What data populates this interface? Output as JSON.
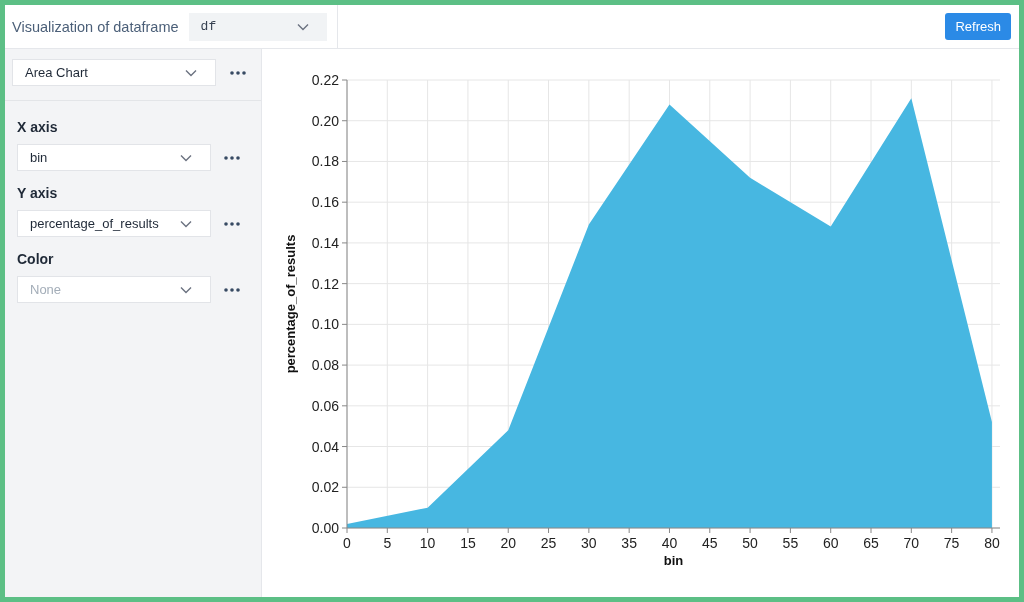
{
  "header": {
    "title": "Visualization of dataframe",
    "dataframe": "df",
    "refresh_button": "Refresh"
  },
  "sidebar": {
    "chart_type": "Area Chart",
    "fields": [
      {
        "label": "X axis",
        "value": "bin"
      },
      {
        "label": "Y axis",
        "value": "percentage_of_results"
      },
      {
        "label": "Color",
        "placeholder": "None"
      }
    ]
  },
  "chart": {
    "chart_data": {
      "type": "area",
      "xlabel": "bin",
      "ylabel": "percentage_of_results",
      "x": [
        0,
        10,
        20,
        30,
        40,
        50,
        60,
        70,
        80
      ],
      "grid": true,
      "series": [
        {
          "color": "#47b7e1",
          "values": [
            0.002,
            0.01,
            0.048,
            0.149,
            0.208,
            0.172,
            0.148,
            0.211,
            0.052
          ]
        }
      ],
      "xlim": [
        0,
        81
      ],
      "ylim": [
        0,
        0.22
      ],
      "xticks": [
        0,
        5,
        10,
        15,
        20,
        25,
        30,
        35,
        40,
        45,
        50,
        55,
        60,
        65,
        70,
        75,
        80
      ],
      "yticks": [
        {
          "value": 0,
          "label": "0.00"
        },
        {
          "value": 0.02,
          "label": "0.02"
        },
        {
          "value": 0.04,
          "label": "0.04"
        },
        {
          "value": 0.06,
          "label": "0.06"
        },
        {
          "value": 0.08,
          "label": "0.08"
        },
        {
          "value": 0.1,
          "label": "0.10"
        },
        {
          "value": 0.12,
          "label": "0.12"
        },
        {
          "value": 0.14,
          "label": "0.14"
        },
        {
          "value": 0.16,
          "label": "0.16"
        },
        {
          "value": 0.18,
          "label": "0.18"
        },
        {
          "value": 0.2,
          "label": "0.20"
        },
        {
          "value": 0.22,
          "label": "0.22"
        }
      ]
    }
  }
}
